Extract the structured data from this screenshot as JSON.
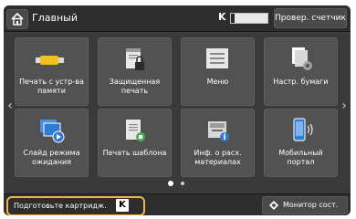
{
  "topbar": {
    "title": "Главный",
    "toner_letter": "K",
    "toner_level": 0.1,
    "counter_label": "Провер. счетчик"
  },
  "tiles": [
    {
      "label": "Печать с устр-ва памяти",
      "icon": "memory-print-icon"
    },
    {
      "label": "Защищенная печать",
      "icon": "secure-print-icon"
    },
    {
      "label": "Меню",
      "icon": "menu-icon"
    },
    {
      "label": "Настр. бумаги",
      "icon": "paper-settings-icon"
    },
    {
      "label": "Слайд режима ожидания",
      "icon": "slideshow-icon"
    },
    {
      "label": "Печать шаблона",
      "icon": "template-print-icon"
    },
    {
      "label": "Инф. о расх. материалах",
      "icon": "consumables-info-icon"
    },
    {
      "label": "Мобильный портал",
      "icon": "mobile-portal-icon"
    }
  ],
  "pager": {
    "pages": 2,
    "current": 1
  },
  "bottombar": {
    "status_text": "Подготовьте картридж.",
    "status_cartridge": "K",
    "monitor_label": "Монитор сост."
  },
  "colors": {
    "screen_bg": "#3a3a3a",
    "tile_bg": "#525252",
    "accent_yellow": "#f3c11c",
    "highlight_orange": "#f0b54a",
    "accent_blue": "#2f7bd4",
    "accent_green": "#4caf50"
  }
}
